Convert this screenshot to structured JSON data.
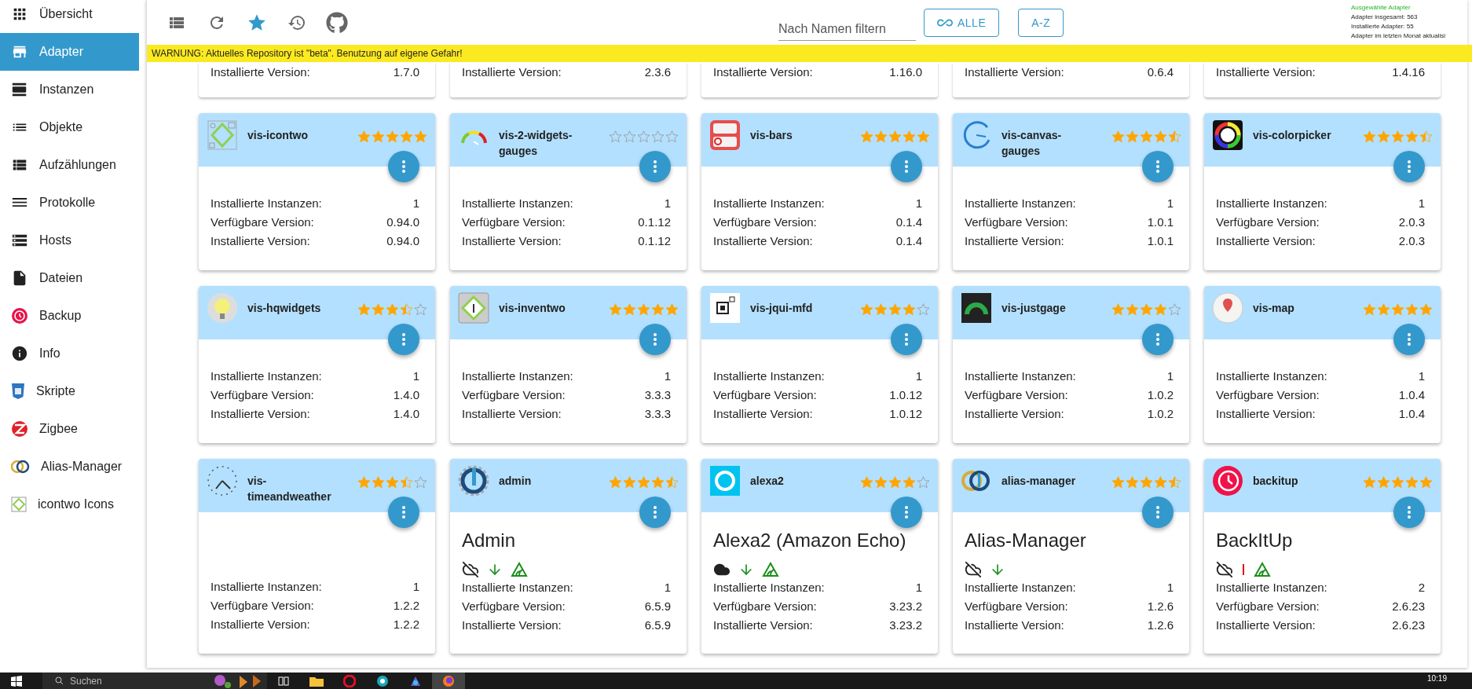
{
  "sidebar": {
    "items": [
      {
        "label": "Übersicht",
        "selected": false
      },
      {
        "label": "Adapter",
        "selected": true
      },
      {
        "label": "Instanzen",
        "selected": false
      },
      {
        "label": "Objekte",
        "selected": false
      },
      {
        "label": "Aufzählungen",
        "selected": false
      },
      {
        "label": "Protokolle",
        "selected": false
      },
      {
        "label": "Hosts",
        "selected": false
      },
      {
        "label": "Dateien",
        "selected": false
      },
      {
        "label": "Backup",
        "selected": false
      },
      {
        "label": "Info",
        "selected": false
      },
      {
        "label": "Skripte",
        "selected": false
      },
      {
        "label": "Zigbee",
        "selected": false
      },
      {
        "label": "Alias-Manager",
        "selected": false
      },
      {
        "label": "icontwo Icons",
        "selected": false
      }
    ]
  },
  "toolbar": {
    "buttons": [
      {
        "kind": "list",
        "selected": false
      },
      {
        "kind": "refresh",
        "selected": false
      },
      {
        "kind": "star",
        "selected": true
      },
      {
        "kind": "history",
        "selected": false
      },
      {
        "kind": "github",
        "selected": false
      }
    ]
  },
  "filter": {
    "placeholder": "Nach Namen filtern"
  },
  "buttons": [
    {
      "label": "ALLE",
      "kind": "infinity"
    },
    {
      "label": "A-Z",
      "kind": "plain"
    }
  ],
  "stats": [
    {
      "text": "Ausgewählte Adapter",
      "kind": "heading"
    },
    {
      "text": "Adapter insgesamt: 563",
      "kind": "line"
    },
    {
      "text": "Installierte Adapter: 55",
      "kind": "line"
    },
    {
      "text": "Adapter im letzten Monat aktualisi",
      "kind": "line"
    }
  ],
  "warning": "WARNUNG: Aktuelles Repository ist \"beta\". Benutzung auf eigene Gefahr!",
  "top_row_cards": [
    {
      "label": "Installierte Version:",
      "value": "1.7.0"
    },
    {
      "label": "Installierte Version:",
      "value": "2.3.6"
    },
    {
      "label": "Installierte Version:",
      "value": "1.16.0"
    },
    {
      "label": "Installierte Version:",
      "value": "0.6.4"
    },
    {
      "label": "Installierte Version:",
      "value": "1.4.16"
    }
  ],
  "cards": [
    {
      "name": "vis-icontwo",
      "stars": 5,
      "rows": [
        {
          "label": "Installierte Instanzen:",
          "value": "1"
        },
        {
          "label": "Verfügbare Version:",
          "value": "0.94.0"
        },
        {
          "label": "Installierte Version:",
          "value": "0.94.0"
        }
      ]
    },
    {
      "name": "vis-2-widgets-gauges",
      "stars": 0,
      "rows": [
        {
          "label": "Installierte Instanzen:",
          "value": "1"
        },
        {
          "label": "Verfügbare Version:",
          "value": "0.1.12"
        },
        {
          "label": "Installierte Version:",
          "value": "0.1.12"
        }
      ]
    },
    {
      "name": "vis-bars",
      "stars": 5,
      "rows": [
        {
          "label": "Installierte Instanzen:",
          "value": "1"
        },
        {
          "label": "Verfügbare Version:",
          "value": "0.1.4"
        },
        {
          "label": "Installierte Version:",
          "value": "0.1.4"
        }
      ]
    },
    {
      "name": "vis-canvas-gauges",
      "stars": 4.5,
      "rows": [
        {
          "label": "Installierte Instanzen:",
          "value": "1"
        },
        {
          "label": "Verfügbare Version:",
          "value": "1.0.1"
        },
        {
          "label": "Installierte Version:",
          "value": "1.0.1"
        }
      ]
    },
    {
      "name": "vis-colorpicker",
      "stars": 4.5,
      "rows": [
        {
          "label": "Installierte Instanzen:",
          "value": "1"
        },
        {
          "label": "Verfügbare Version:",
          "value": "2.0.3"
        },
        {
          "label": "Installierte Version:",
          "value": "2.0.3"
        }
      ]
    },
    {
      "name": "vis-hqwidgets",
      "stars": 3.5,
      "rows": [
        {
          "label": "Installierte Instanzen:",
          "value": "1"
        },
        {
          "label": "Verfügbare Version:",
          "value": "1.4.0"
        },
        {
          "label": "Installierte Version:",
          "value": "1.4.0"
        }
      ]
    },
    {
      "name": "vis-inventwo",
      "stars": 5,
      "rows": [
        {
          "label": "Installierte Instanzen:",
          "value": "1"
        },
        {
          "label": "Verfügbare Version:",
          "value": "3.3.3"
        },
        {
          "label": "Installierte Version:",
          "value": "3.3.3"
        }
      ]
    },
    {
      "name": "vis-jqui-mfd",
      "stars": 4,
      "rows": [
        {
          "label": "Installierte Instanzen:",
          "value": "1"
        },
        {
          "label": "Verfügbare Version:",
          "value": "1.0.12"
        },
        {
          "label": "Installierte Version:",
          "value": "1.0.12"
        }
      ]
    },
    {
      "name": "vis-justgage",
      "stars": 4,
      "rows": [
        {
          "label": "Installierte Instanzen:",
          "value": "1"
        },
        {
          "label": "Verfügbare Version:",
          "value": "1.0.2"
        },
        {
          "label": "Installierte Version:",
          "value": "1.0.2"
        }
      ]
    },
    {
      "name": "vis-map",
      "stars": 5,
      "rows": [
        {
          "label": "Installierte Instanzen:",
          "value": "1"
        },
        {
          "label": "Verfügbare Version:",
          "value": "1.0.4"
        },
        {
          "label": "Installierte Version:",
          "value": "1.0.4"
        }
      ]
    },
    {
      "name": "vis-timeandweather",
      "stars": 3.5,
      "rows": [
        {
          "label": "Installierte Instanzen:",
          "value": "1"
        },
        {
          "label": "Verfügbare Version:",
          "value": "1.2.2"
        },
        {
          "label": "Installierte Version:",
          "value": "1.2.2"
        }
      ]
    },
    {
      "name": "admin",
      "stars": 4.5,
      "title": "Admin",
      "status": [
        {
          "kind": "cloud-off"
        },
        {
          "kind": "arrow-down"
        },
        {
          "kind": "signal"
        }
      ],
      "rows": [
        {
          "label": "Installierte Instanzen:",
          "value": "1"
        },
        {
          "label": "Verfügbare Version:",
          "value": "6.5.9"
        },
        {
          "label": "Installierte Version:",
          "value": "6.5.9"
        }
      ]
    },
    {
      "name": "alexa2",
      "stars": 4,
      "title": "Alexa2 (Amazon Echo)",
      "status": [
        {
          "kind": "cloud"
        },
        {
          "kind": "arrow-down"
        },
        {
          "kind": "signal"
        }
      ],
      "rows": [
        {
          "label": "Installierte Instanzen:",
          "value": "1"
        },
        {
          "label": "Verfügbare Version:",
          "value": "3.23.2"
        },
        {
          "label": "Installierte Version:",
          "value": "3.23.2"
        }
      ]
    },
    {
      "name": "alias-manager",
      "stars": 4.5,
      "title": "Alias-Manager",
      "status": [
        {
          "kind": "cloud-off"
        },
        {
          "kind": "arrow-down"
        }
      ],
      "rows": [
        {
          "label": "Installierte Instanzen:",
          "value": "1"
        },
        {
          "label": "Verfügbare Version:",
          "value": "1.2.6"
        },
        {
          "label": "Installierte Version:",
          "value": "1.2.6"
        }
      ]
    },
    {
      "name": "backitup",
      "stars": 5,
      "title": "BackItUp",
      "status": [
        {
          "kind": "cloud-off"
        },
        {
          "kind": "error"
        },
        {
          "kind": "signal"
        }
      ],
      "rows": [
        {
          "label": "Installierte Instanzen:",
          "value": "2"
        },
        {
          "label": "Verfügbare Version:",
          "value": "2.6.23"
        },
        {
          "label": "Installierte Version:",
          "value": "2.6.23"
        }
      ]
    }
  ],
  "taskbar": {
    "search_placeholder": "Suchen",
    "time": "10:19"
  }
}
